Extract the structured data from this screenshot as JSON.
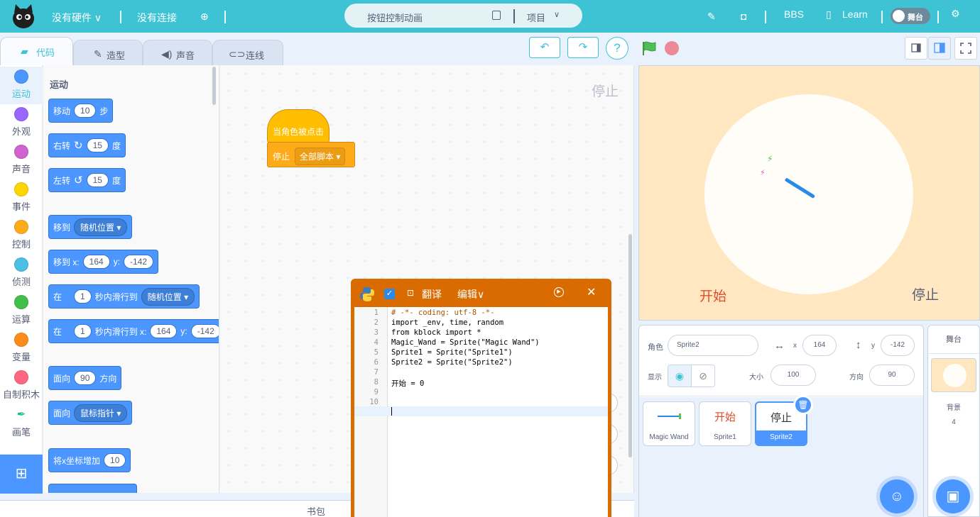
{
  "menubar": {
    "hardware": "没有硬件",
    "connection": "没有连接",
    "project_title": "按钮控制动画",
    "project_menu": "项目",
    "bbs": "BBS",
    "learn": "Learn",
    "stage_toggle": "舞台"
  },
  "tabs": [
    {
      "label": "代码",
      "icon": "code-icon"
    },
    {
      "label": "造型",
      "icon": "brush-icon"
    },
    {
      "label": "声音",
      "icon": "speaker-icon"
    },
    {
      "label": "连线",
      "icon": "wire-icon"
    }
  ],
  "categories": [
    {
      "label": "运动",
      "color": "#4c97ff"
    },
    {
      "label": "外观",
      "color": "#9966ff"
    },
    {
      "label": "声音",
      "color": "#cf63cf"
    },
    {
      "label": "事件",
      "color": "#ffd500"
    },
    {
      "label": "控制",
      "color": "#ffab19"
    },
    {
      "label": "侦测",
      "color": "#4cbfe6"
    },
    {
      "label": "运算",
      "color": "#40bf4a"
    },
    {
      "label": "变量",
      "color": "#ff8c1a"
    },
    {
      "label": "自制积木",
      "color": "#ff6680"
    },
    {
      "label": "画笔",
      "color": "#0fbd8c"
    }
  ],
  "palette": {
    "heading": "运动",
    "move": {
      "label": "移动",
      "value": "10",
      "unit": "步"
    },
    "turn_right": {
      "label": "右转",
      "value": "15",
      "unit": "度"
    },
    "turn_left": {
      "label": "左转",
      "value": "15",
      "unit": "度"
    },
    "goto": {
      "label": "移到",
      "option": "随机位置"
    },
    "goto_xy": {
      "label": "移到 x:",
      "x": "164",
      "ylabel": "y:",
      "y": "-142"
    },
    "glide": {
      "prefix": "在",
      "secs": "1",
      "mid": "秒内滑行到",
      "option": "随机位置"
    },
    "glide_xy": {
      "prefix": "在",
      "secs": "1",
      "mid": "秒内滑行到 x:",
      "x": "164",
      "ylabel": "y:",
      "y": "-142"
    },
    "point_dir": {
      "label": "面向",
      "value": "90",
      "unit": "方向"
    },
    "point_towards": {
      "label": "面向",
      "option": "鼠标指针"
    },
    "change_x": {
      "label": "将x坐标增加",
      "value": "10"
    }
  },
  "workspace": {
    "sprite_label": "停止",
    "hat_block": "当角色被点击",
    "stop_label": "停止",
    "stop_option": "全部脚本"
  },
  "backpack": "书包",
  "code_window": {
    "translate": "翻译",
    "edit": "编辑∨",
    "lines": [
      "1",
      "2",
      "3",
      "4",
      "5",
      "6",
      "7",
      "8",
      "9",
      "10",
      "11"
    ],
    "code": [
      "# -*- coding: utf-8 -*-",
      "import _env, time, random",
      "from kblock import *",
      "Magic_Wand = Sprite(\"Magic Wand\")",
      "Sprite1 = Sprite(\"Sprite1\")",
      "Sprite2 = Sprite(\"Sprite2\")",
      "",
      "开始 = 0",
      "",
      "",
      ""
    ]
  },
  "stage": {
    "start_text": "开始",
    "stop_text": "停止"
  },
  "sprite_info": {
    "sprite_label": "角色",
    "sprite_name": "Sprite2",
    "x_label": "x",
    "x": "164",
    "y_label": "y",
    "y": "-142",
    "show_label": "显示",
    "size_label": "大小",
    "size": "100",
    "direction_label": "方向",
    "direction": "90"
  },
  "sprites": [
    {
      "name": "Magic Wand",
      "preview": ""
    },
    {
      "name": "Sprite1",
      "preview": "开始"
    },
    {
      "name": "Sprite2",
      "preview": "停止"
    }
  ],
  "stage_pane": {
    "heading": "舞台",
    "backdrops_label": "背景",
    "backdrops_count": "4"
  }
}
